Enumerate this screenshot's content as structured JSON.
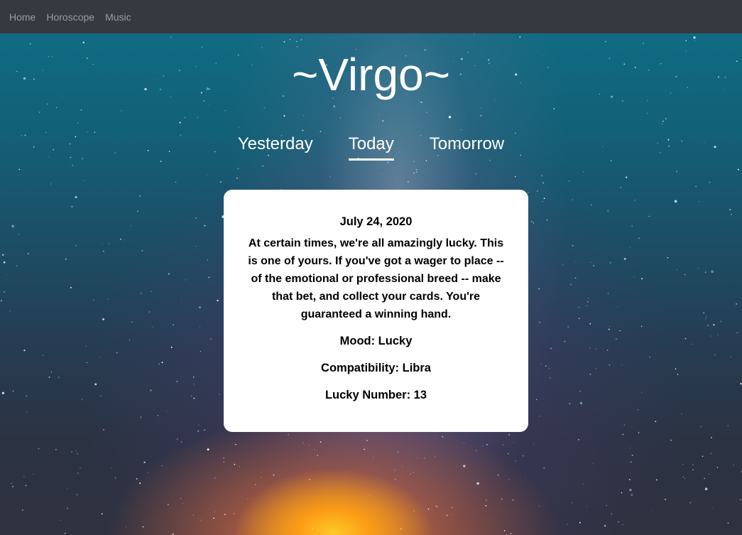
{
  "nav": {
    "items": [
      {
        "label": "Home"
      },
      {
        "label": "Horoscope"
      },
      {
        "label": "Music"
      }
    ]
  },
  "sign": {
    "title": "~Virgo~"
  },
  "tabs": [
    {
      "label": "Yesterday",
      "active": false
    },
    {
      "label": "Today",
      "active": true
    },
    {
      "label": "Tomorrow",
      "active": false
    }
  ],
  "horoscope": {
    "date": "July 24, 2020",
    "description": "At certain times, we're all amazingly lucky. This is one of yours. If you've got a wager to place -- of the emotional or professional breed -- make that bet, and collect your cards. You're guaranteed a winning hand.",
    "mood": "Mood: Lucky",
    "compatibility": "Compatibility: Libra",
    "lucky_number": "Lucky Number: 13"
  },
  "colors": {
    "navbar": "#343a40",
    "nav_link": "#9a9da0",
    "card": "#ffffff",
    "text_light": "#ffffff"
  }
}
